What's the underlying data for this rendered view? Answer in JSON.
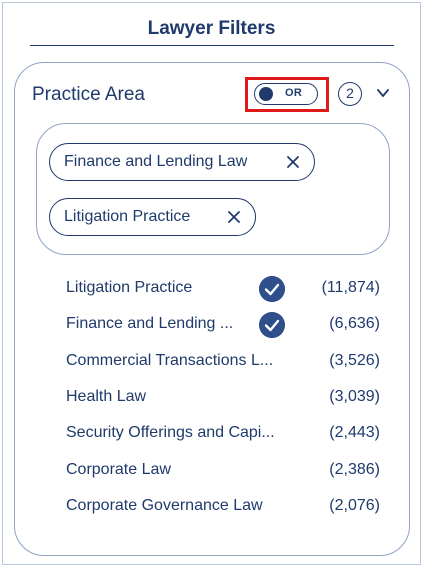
{
  "header": {
    "title": "Lawyer Filters"
  },
  "section": {
    "title": "Practice Area",
    "toggle_label": "OR",
    "selected_count": "2"
  },
  "chips": [
    {
      "label": "Finance and Lending Law"
    },
    {
      "label": "Litigation Practice"
    }
  ],
  "items": [
    {
      "label": "Litigation Practice",
      "count": "(11,874)",
      "checked": true
    },
    {
      "label": "Finance and Lending ...",
      "count": "(6,636)",
      "checked": true
    },
    {
      "label": "Commercial Transactions L...",
      "count": "(3,526)",
      "checked": false
    },
    {
      "label": "Health Law",
      "count": "(3,039)",
      "checked": false
    },
    {
      "label": "Security Offerings and Capi...",
      "count": "(2,443)",
      "checked": false
    },
    {
      "label": "Corporate Law",
      "count": "(2,386)",
      "checked": false
    },
    {
      "label": "Corporate Governance Law",
      "count": "(2,076)",
      "checked": false
    }
  ],
  "icons": {
    "chevron": "chevron-down-icon",
    "close": "close-icon",
    "check": "check-icon"
  },
  "colors": {
    "primary": "#1f3a6b",
    "check_fill": "#2f4f8a",
    "border": "#8fa3c7",
    "highlight": "#e01a1a"
  }
}
